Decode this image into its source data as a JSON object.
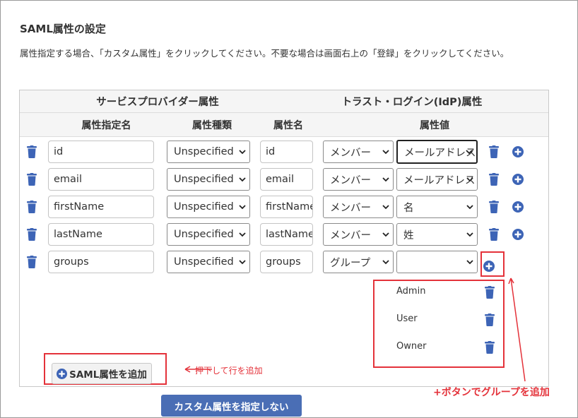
{
  "page": {
    "title": "SAML属性の設定",
    "description": "属性指定する場合、「カスタム属性」をクリックしてください。不要な場合は画面右上の「登録」をクリックしてください。"
  },
  "table": {
    "group_header_sp": "サービスプロバイダー属性",
    "group_header_idp": "トラスト・ログイン(IdP)属性",
    "col_attr_spec_name": "属性指定名",
    "col_attr_type": "属性種類",
    "col_attr_name": "属性名",
    "col_attr_value": "属性値",
    "rows": [
      {
        "spec_name": "id",
        "type": "Unspecified",
        "attr_name": "id",
        "source": "メンバー",
        "value": "メールアドレス"
      },
      {
        "spec_name": "email",
        "type": "Unspecified",
        "attr_name": "email",
        "source": "メンバー",
        "value": "メールアドレス"
      },
      {
        "spec_name": "firstName",
        "type": "Unspecified",
        "attr_name": "firstName",
        "source": "メンバー",
        "value": "名"
      },
      {
        "spec_name": "lastName",
        "type": "Unspecified",
        "attr_name": "lastName",
        "source": "メンバー",
        "value": "姓"
      },
      {
        "spec_name": "groups",
        "type": "Unspecified",
        "attr_name": "groups",
        "source": "グループ",
        "value": ""
      }
    ],
    "group_items": [
      "Admin",
      "User",
      "Owner"
    ]
  },
  "buttons": {
    "add_saml_attr": "SAML属性を追加",
    "no_custom_attr": "カスタム属性を指定しない"
  },
  "annotations": {
    "add_row_note": "押下して行を追加",
    "add_group_note": "+ボタンでグループを追加"
  },
  "colors": {
    "accent_blue": "#3d64b6",
    "button_blue": "#4a6eb5",
    "annotation_red": "#e4323a"
  }
}
